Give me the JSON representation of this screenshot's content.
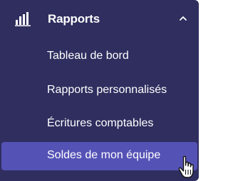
{
  "menu": {
    "header": {
      "label": "Rapports",
      "icon": "bar-chart-icon",
      "toggle_icon": "chevron-up-icon"
    },
    "items": [
      {
        "label": "Tableau de bord"
      },
      {
        "label": "Rapports personnalisés"
      },
      {
        "label": "Écritures comptables"
      },
      {
        "label": "Soldes de mon équipe",
        "state": "active"
      }
    ]
  },
  "pointer": {
    "icon": "hand-pointer-icon"
  },
  "colors": {
    "panel": "#2f2e5f",
    "active": "#5552b6",
    "text": "#ffffff"
  }
}
